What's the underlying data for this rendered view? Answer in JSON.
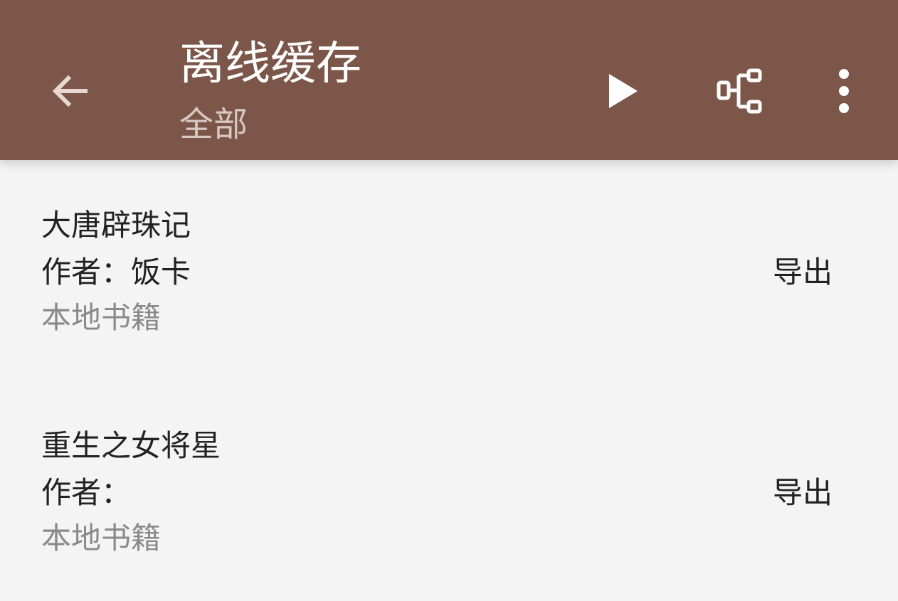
{
  "appbar": {
    "background": "#7b5649",
    "title": "离线缓存",
    "subtitle": "全部",
    "back_icon": "arrow-left-icon",
    "actions": [
      {
        "name": "play-icon"
      },
      {
        "name": "tree-icon"
      },
      {
        "name": "more-vertical-icon"
      }
    ]
  },
  "books": [
    {
      "name": "大唐辟珠记",
      "author_prefix": "作者：",
      "author": "饭卡",
      "origin": "本地书籍",
      "export_label": "导出"
    },
    {
      "name": "重生之女将星",
      "author_prefix": "作者：",
      "author": "",
      "origin": "本地书籍",
      "export_label": "导出"
    }
  ]
}
